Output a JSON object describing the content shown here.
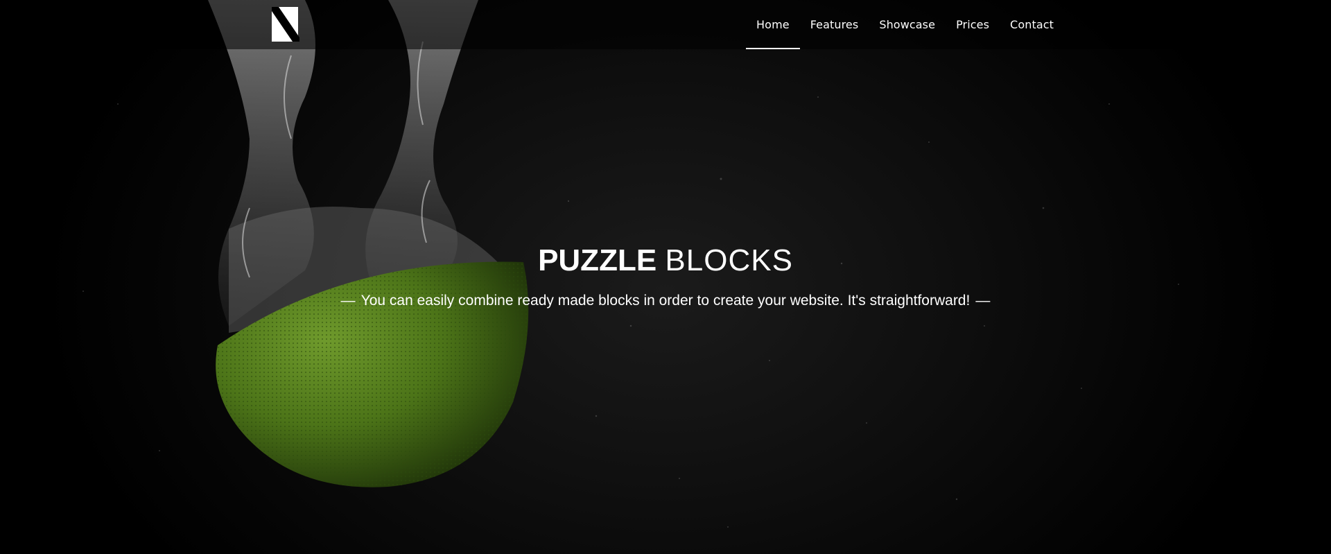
{
  "brand": {
    "logo_icon": "n-monogram-logo-icon"
  },
  "nav": {
    "items": [
      {
        "label": "Home",
        "active": true
      },
      {
        "label": "Features",
        "active": false
      },
      {
        "label": "Showcase",
        "active": false
      },
      {
        "label": "Prices",
        "active": false
      },
      {
        "label": "Contact",
        "active": false
      }
    ]
  },
  "hero": {
    "title_strong": "PUZZLE",
    "title_light": "BLOCKS",
    "subtitle_dash_left": "—",
    "subtitle": "You can easily combine ready made blocks in order to create your website. It's straightforward!",
    "subtitle_dash_right": "—",
    "background_image": "lime-splashing-into-water-photo"
  },
  "colors": {
    "background": "#000000",
    "text": "#ffffff",
    "lime": "#4f7a1c"
  }
}
